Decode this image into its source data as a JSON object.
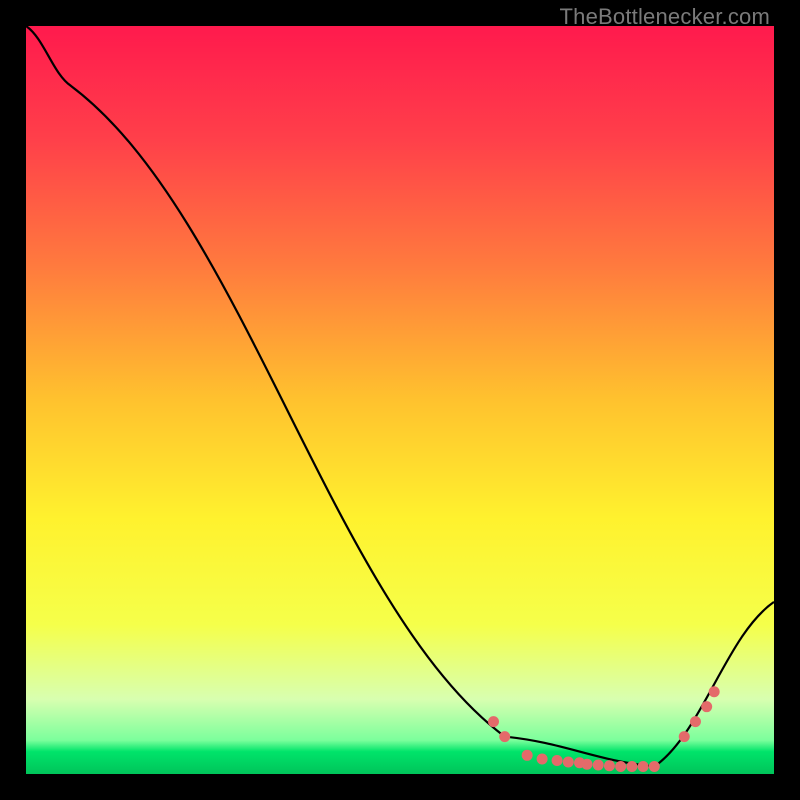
{
  "watermark": "TheBottlenecker.com",
  "chart_data": {
    "type": "line",
    "title": "",
    "xlabel": "",
    "ylabel": "",
    "xlim": [
      0,
      100
    ],
    "ylim": [
      0,
      100
    ],
    "grid": false,
    "green_band": {
      "y_percent_from_bottom": 4,
      "width_percent": 4
    },
    "series": [
      {
        "name": "curve",
        "x": [
          0,
          6,
          64,
          84,
          100
        ],
        "y": [
          100,
          92,
          5,
          1,
          23
        ]
      }
    ],
    "markers": {
      "name": "highlight-points",
      "color": "#e46a6a",
      "points": [
        {
          "x": 62.5,
          "y": 7
        },
        {
          "x": 64,
          "y": 5
        },
        {
          "x": 67,
          "y": 2.5
        },
        {
          "x": 69,
          "y": 2
        },
        {
          "x": 71,
          "y": 1.8
        },
        {
          "x": 72.5,
          "y": 1.6
        },
        {
          "x": 74,
          "y": 1.5
        },
        {
          "x": 75,
          "y": 1.3
        },
        {
          "x": 76.5,
          "y": 1.2
        },
        {
          "x": 78,
          "y": 1.1
        },
        {
          "x": 79.5,
          "y": 1
        },
        {
          "x": 81,
          "y": 1
        },
        {
          "x": 82.5,
          "y": 1
        },
        {
          "x": 84,
          "y": 1
        },
        {
          "x": 88,
          "y": 5
        },
        {
          "x": 89.5,
          "y": 7
        },
        {
          "x": 91,
          "y": 9
        },
        {
          "x": 92,
          "y": 11
        }
      ]
    },
    "gradient_stops": [
      {
        "offset": 0,
        "color": "#ff1a4d"
      },
      {
        "offset": 0.15,
        "color": "#ff3f4a"
      },
      {
        "offset": 0.32,
        "color": "#ff7a3e"
      },
      {
        "offset": 0.5,
        "color": "#ffc22e"
      },
      {
        "offset": 0.66,
        "color": "#fff22e"
      },
      {
        "offset": 0.8,
        "color": "#f5ff4a"
      },
      {
        "offset": 0.9,
        "color": "#d8ffb0"
      },
      {
        "offset": 0.955,
        "color": "#7bff9c"
      },
      {
        "offset": 0.97,
        "color": "#00e46a"
      },
      {
        "offset": 1.0,
        "color": "#00c45a"
      }
    ]
  }
}
